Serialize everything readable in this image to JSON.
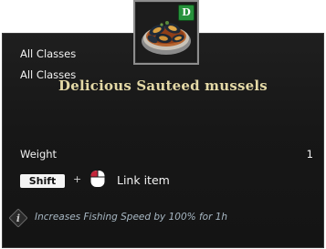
{
  "item": {
    "name": "Delicious Sauteed mussels",
    "grade_badge": "D",
    "icon": "mussel-bowl-icon",
    "name_color": "#e4d9a6",
    "badge_color": "#27923c"
  },
  "classes": [
    "All Classes",
    "All Classes"
  ],
  "stats": {
    "weight_label": "Weight",
    "weight_value": "1"
  },
  "controls": {
    "key_label": "Shift",
    "plus": "+",
    "mouse_icon": "mouse-click-icon",
    "action_label": "Link item"
  },
  "effect": {
    "icon": "info-icon",
    "text": "Increases Fishing Speed by 100% for 1h"
  }
}
